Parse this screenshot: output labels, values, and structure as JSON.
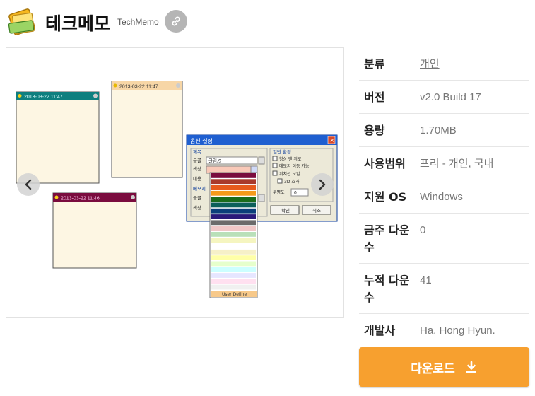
{
  "app": {
    "title": "테크메모",
    "subtitle": "TechMemo"
  },
  "icons": {
    "app": "sticky-note-icon",
    "link": "link-icon",
    "prev": "chevron-left-icon",
    "next": "chevron-right-icon",
    "download": "download-icon"
  },
  "screenshot": {
    "memos": [
      {
        "date": "2013-03-22 11:47",
        "bar_color": "#0e7f7f"
      },
      {
        "date": "2013-03-22 11:47",
        "bar_color": "#f7d6a6"
      },
      {
        "date": "2013-03-22 11:46",
        "bar_color": "#7a0c3e"
      }
    ],
    "dialog": {
      "title": "옵션 설정",
      "group_title": "제목",
      "font_label": "글꼴",
      "font_value": "굴림,9",
      "color_label": "색상",
      "content_label": "내용",
      "memo_label": "메모지",
      "general_title": "일반 환경",
      "checks": [
        "항상 맨 위로",
        "메모지 이동 가능",
        "위치션 보임",
        "3D 효과"
      ],
      "opacity_label": "투명도",
      "opacity_value": "0",
      "ok_label": "확인",
      "cancel_label": "취소",
      "user_define": "User Define",
      "swatches": [
        "#7a0c3e",
        "#a8392b",
        "#e65a1c",
        "#f59a1a",
        "#1b6b1b",
        "#0c5f5a",
        "#0b3f7a",
        "#2a1a7a",
        "#6b6b6b",
        "#f0c8c8",
        "#b9e0b9",
        "#f5f5c0",
        "#ffffff",
        "#f6f0c8",
        "#ffffa8",
        "#e6ffcc",
        "#ccffff",
        "#e6e6ff",
        "#ffe0f0",
        "#f0f0f0"
      ]
    }
  },
  "info": [
    {
      "key": "분류",
      "value": "개인",
      "link": true
    },
    {
      "key": "버전",
      "value": "v2.0 Build 17"
    },
    {
      "key": "용량",
      "value": "1.70MB"
    },
    {
      "key": "사용범위",
      "value": "프리 - 개인, 국내"
    },
    {
      "key": "지원 OS",
      "value": "Windows"
    },
    {
      "key": "금주 다운수",
      "value": "0"
    },
    {
      "key": "누적 다운수",
      "value": "41"
    },
    {
      "key": "개발사",
      "value": "Ha. Hong Hyun."
    }
  ],
  "download": {
    "label": "다운로드",
    "color": "#f7a02f"
  }
}
